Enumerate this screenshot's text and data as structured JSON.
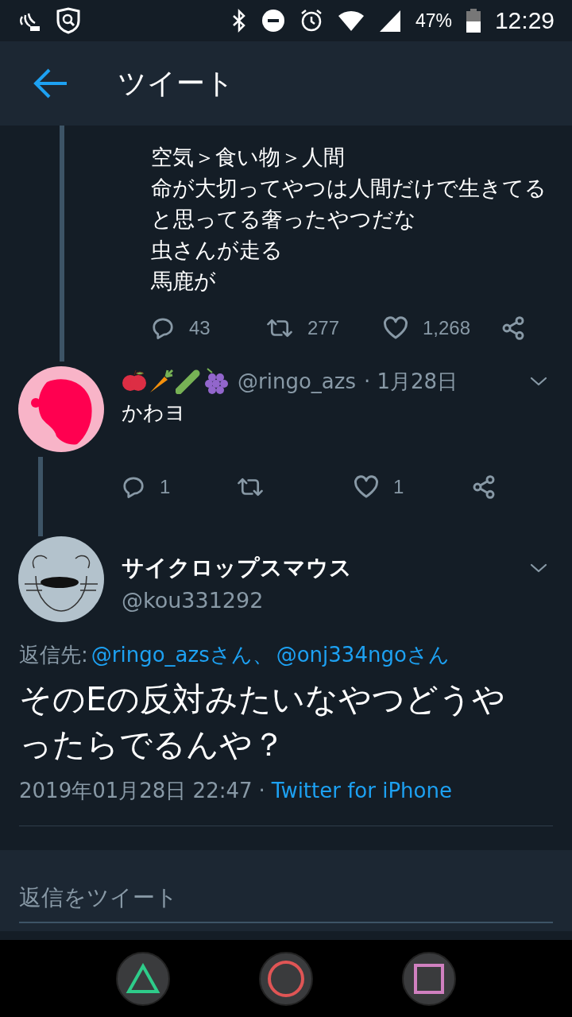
{
  "status_bar": {
    "battery": "47%",
    "time": "12:29"
  },
  "header": {
    "title": "ツイート"
  },
  "thread_tweet": {
    "lines": [
      "空気＞食い物＞人間",
      "命が大切ってやつは人間だけで生きてる",
      "と思ってる奢ったやつだな",
      "虫さんが走る",
      "馬鹿が"
    ],
    "actions": {
      "replies": "43",
      "retweets": "277",
      "likes": "1,268"
    }
  },
  "reply_tweet": {
    "handle": "@ringo_azs",
    "date": "· 1月28日",
    "text": "かわヨ",
    "actions": {
      "replies": "1",
      "likes": "1"
    }
  },
  "main_tweet": {
    "name": "サイクロップスマウス",
    "handle": "@kou331292",
    "reply_to_label": "返信先:",
    "reply_to": [
      "@ringo_azsさん",
      "@onj334ngoさん"
    ],
    "reply_to_separator": "、",
    "text": "そのEの反対みたいなやつどうやったらでるんや？",
    "timestamp": "2019年01月28日 22:47",
    "source_separator": "·",
    "source": "Twitter for iPhone"
  },
  "reply_box": {
    "placeholder": "返信をツイート"
  }
}
